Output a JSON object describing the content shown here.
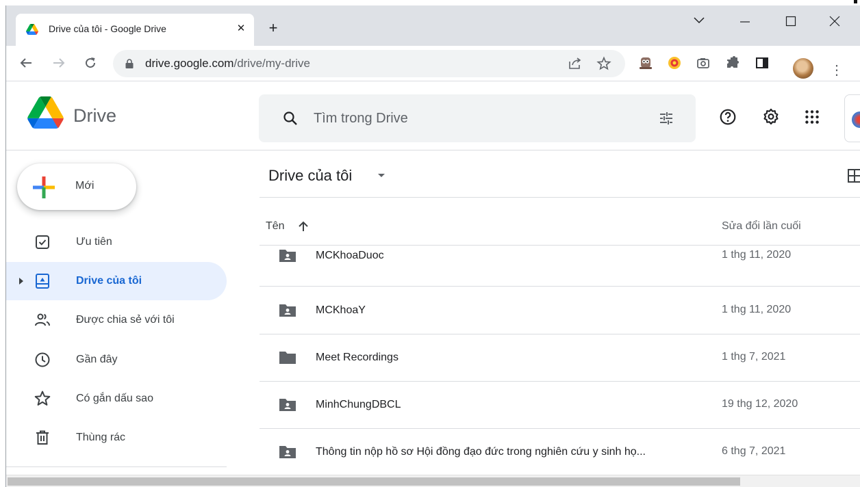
{
  "browser": {
    "tab": {
      "title": "Drive của tôi - Google Drive",
      "close_glyph": "✕"
    },
    "new_tab_glyph": "+",
    "address": {
      "domain": "drive.google.com",
      "path": "/drive/my-drive"
    },
    "menu_glyph": "⋮"
  },
  "app": {
    "name": "Drive",
    "search": {
      "placeholder": "Tìm trong Drive"
    }
  },
  "sidebar": {
    "new_button": "Mới",
    "items": [
      {
        "label": "Ưu tiên",
        "icon": "priority-check-icon",
        "active": false
      },
      {
        "label": "Drive của tôi",
        "icon": "my-drive-icon",
        "active": true
      },
      {
        "label": "Được chia sẻ với tôi",
        "icon": "shared-people-icon",
        "active": false
      },
      {
        "label": "Gần đây",
        "icon": "clock-icon",
        "active": false
      },
      {
        "label": "Có gắn dấu sao",
        "icon": "star-icon",
        "active": false
      },
      {
        "label": "Thùng rác",
        "icon": "trash-icon",
        "active": false
      }
    ]
  },
  "main": {
    "title": "Drive của tôi",
    "columns": {
      "name": "Tên",
      "modified": "Sửa đổi lần cuối"
    },
    "files": [
      {
        "name": "MCKhoaDuoc",
        "modified": "1 thg 11, 2020",
        "icon": "shared-folder-icon"
      },
      {
        "name": "MCKhoaY",
        "modified": "1 thg 11, 2020",
        "icon": "shared-folder-icon"
      },
      {
        "name": "Meet Recordings",
        "modified": "1 thg 7, 2021",
        "icon": "folder-icon"
      },
      {
        "name": "MinhChungDBCL",
        "modified": "19 thg 12, 2020",
        "icon": "shared-folder-icon"
      },
      {
        "name": "Thông tin nộp hồ sơ Hội đồng đạo đức trong nghiên cứu y sinh họ...",
        "modified": "6 thg 7, 2021",
        "icon": "shared-folder-icon"
      }
    ]
  },
  "colors": {
    "accent": "#1967d2",
    "active_bg": "#e8f0fe",
    "folder": "#5f6368",
    "tabbar": "#dee1e6"
  }
}
